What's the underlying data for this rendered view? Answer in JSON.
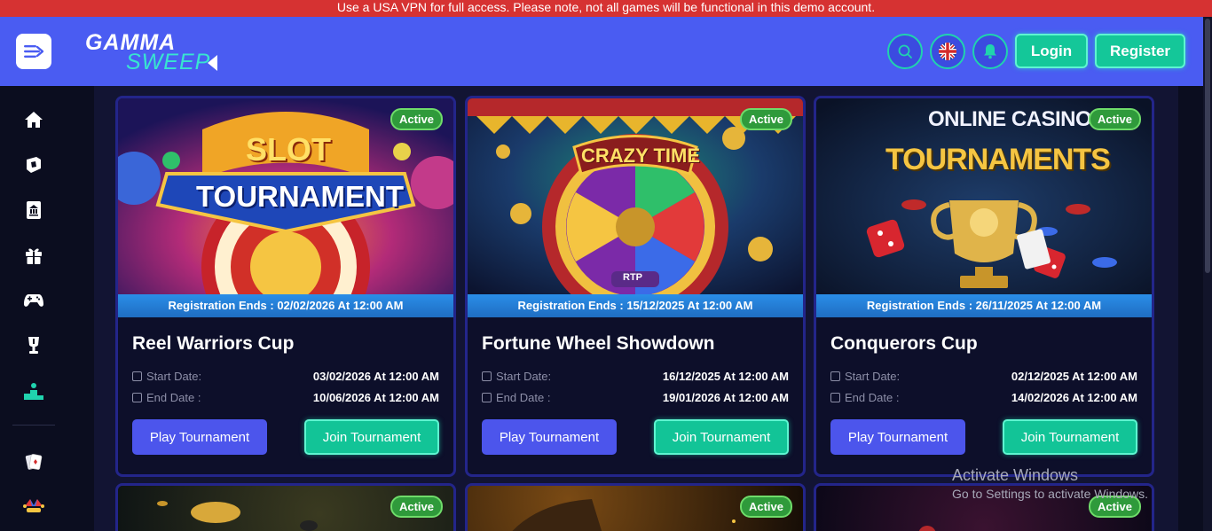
{
  "banner": {
    "text": "Use a USA VPN for full access. Please note, not all games will be functional in this demo account."
  },
  "header": {
    "logo_top": "GAMMA",
    "logo_bottom": "SWEEP",
    "login_label": "Login",
    "register_label": "Register"
  },
  "sidebar": {
    "items": [
      "home-icon",
      "shield-icon",
      "bank-icon",
      "gift-icon",
      "gamepad-icon",
      "trophy-icon",
      "podium-icon",
      "cards-icon",
      "jester-icon"
    ],
    "active_color": "#20d3ae"
  },
  "cards": [
    {
      "image_text_1": "SLOT",
      "image_text_2": "TOURNAMENT",
      "status": "Active",
      "registration": "Registration Ends : 02/02/2026 At 12:00 AM",
      "title": "Reel Warriors Cup",
      "start_label": "Start Date:",
      "start_value": "03/02/2026 At 12:00 AM",
      "end_label": "End Date :",
      "end_value": "10/06/2026 At 12:00 AM",
      "play_label": "Play Tournament",
      "join_label": "Join Tournament"
    },
    {
      "image_text_1": "CRAZY TIME",
      "image_text_2": "RTP",
      "status": "Active",
      "registration": "Registration Ends : 15/12/2025 At 12:00 AM",
      "title": "Fortune Wheel Showdown",
      "start_label": "Start Date:",
      "start_value": "16/12/2025 At 12:00 AM",
      "end_label": "End Date :",
      "end_value": "19/01/2026 At 12:00 AM",
      "play_label": "Play Tournament",
      "join_label": "Join Tournament"
    },
    {
      "image_text_1": "ONLINE CASINO",
      "image_text_2": "TOURNAMENTS",
      "status": "Active",
      "registration": "Registration Ends : 26/11/2025 At 12:00 AM",
      "title": "Conquerors Cup",
      "start_label": "Start Date:",
      "start_value": "02/12/2025 At 12:00 AM",
      "end_label": "End Date :",
      "end_value": "14/02/2026 At 12:00 AM",
      "play_label": "Play Tournament",
      "join_label": "Join Tournament"
    }
  ],
  "next_row": [
    {
      "status": "Active"
    },
    {
      "status": "Active"
    },
    {
      "status": "Active"
    }
  ],
  "watermark": {
    "line1": "Activate Windows",
    "line2": "Go to Settings to activate Windows."
  }
}
